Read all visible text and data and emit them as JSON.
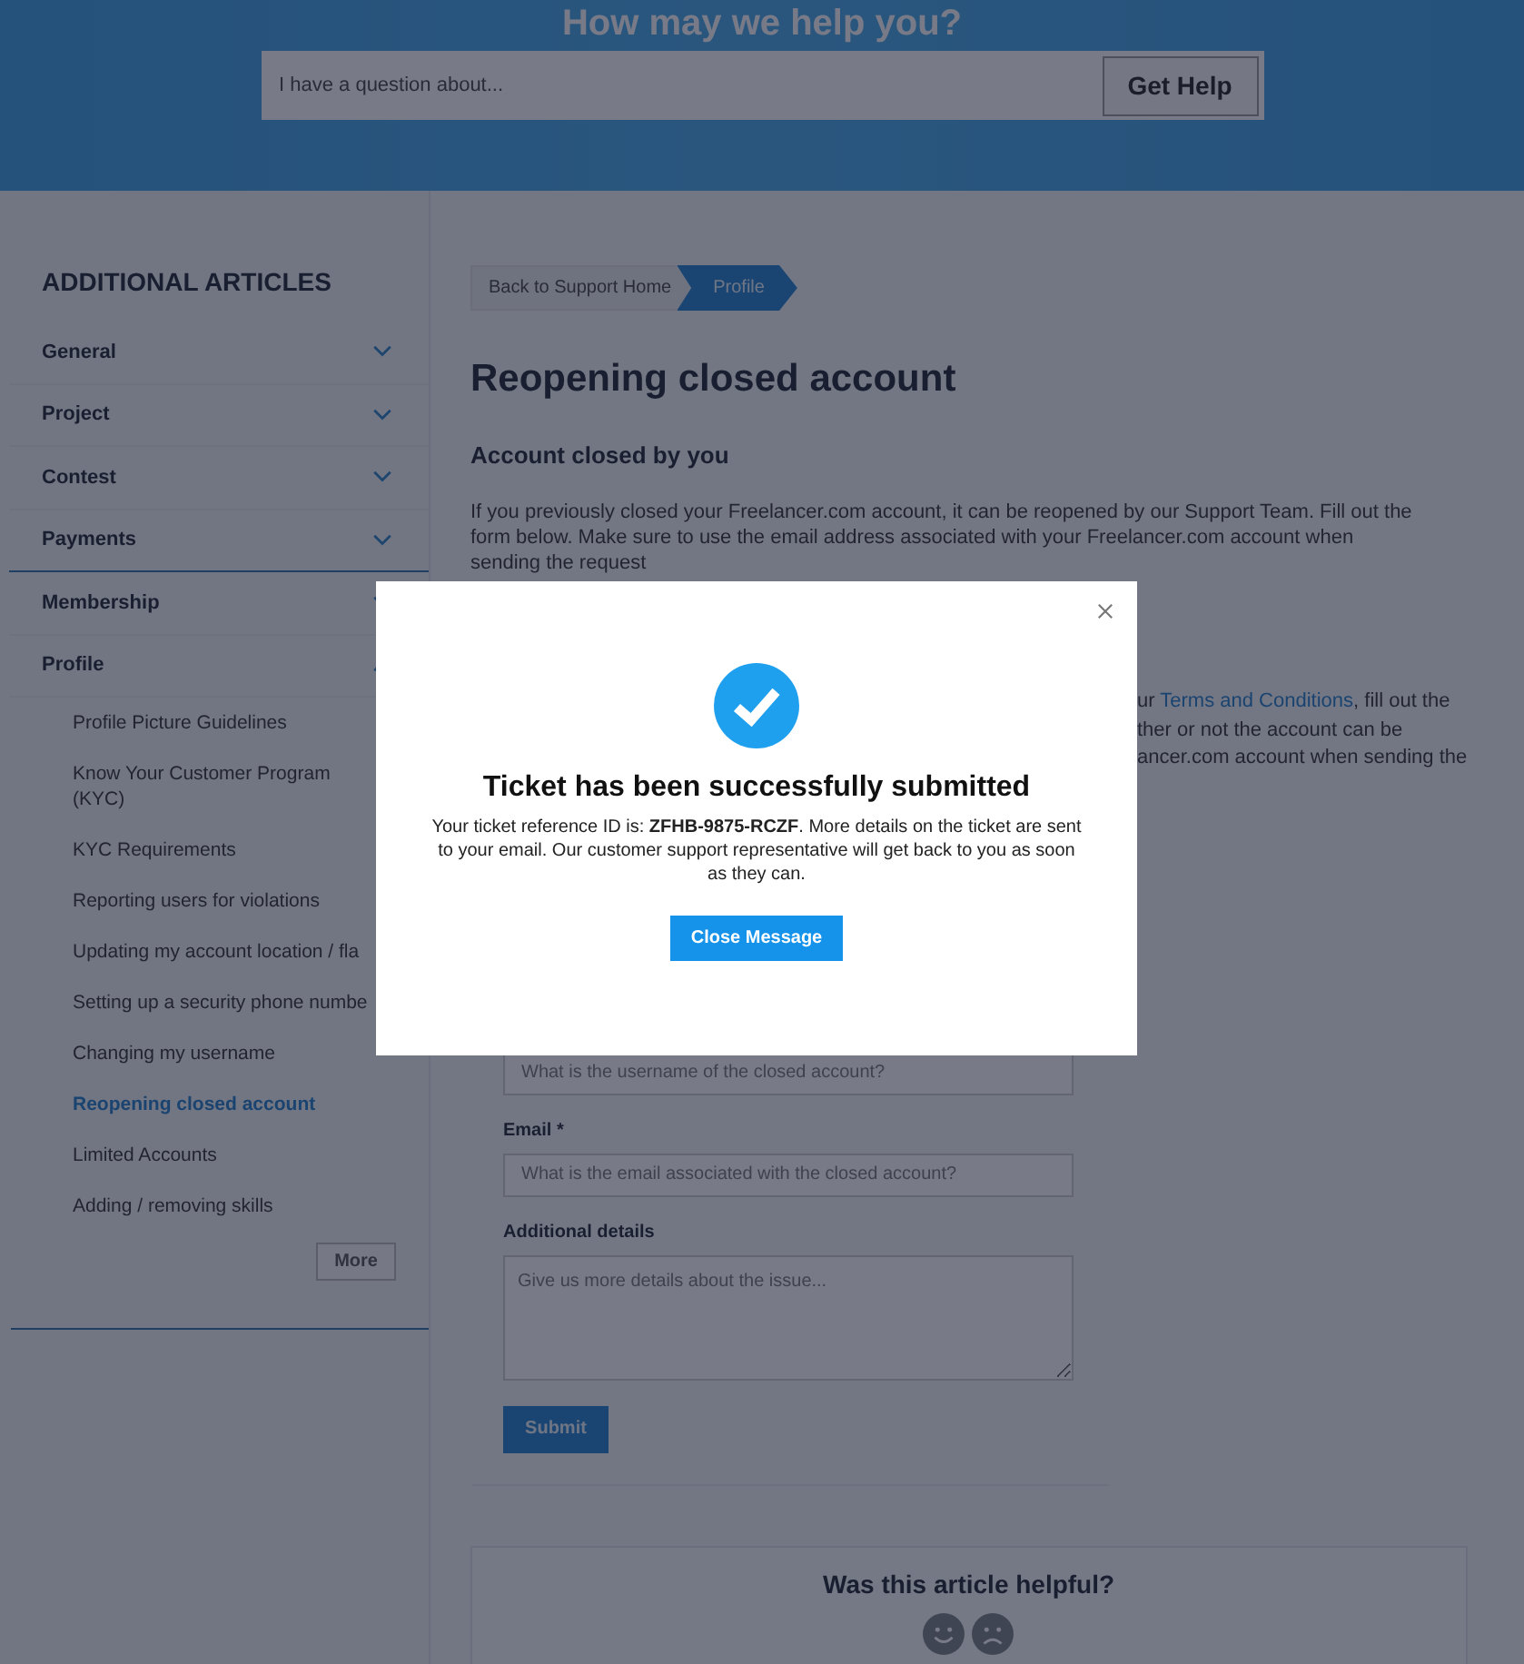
{
  "header": {
    "title": "How may we help you?",
    "search": {
      "placeholder": "I have a question about..."
    },
    "button": "Get Help"
  },
  "sidebar": {
    "title": "ADDITIONAL ARTICLES",
    "categories": [
      {
        "label": "General",
        "expanded": false
      },
      {
        "label": "Project",
        "expanded": false
      },
      {
        "label": "Contest",
        "expanded": false
      },
      {
        "label": "Payments",
        "expanded": false
      },
      {
        "label": "Membership",
        "expanded": false
      },
      {
        "label": "Profile",
        "expanded": true,
        "items": [
          {
            "label": "Profile Picture Guidelines",
            "selected": false
          },
          {
            "label": "Know Your Customer Program (KYC)",
            "selected": false
          },
          {
            "label": "KYC Requirements",
            "selected": false
          },
          {
            "label": "Reporting users for violations",
            "selected": false
          },
          {
            "label": "Updating my account location / fla",
            "selected": false
          },
          {
            "label": "Setting up a security phone numbe",
            "selected": false
          },
          {
            "label": "Changing my username",
            "selected": false
          },
          {
            "label": "Reopening closed account",
            "selected": true
          },
          {
            "label": "Limited Accounts",
            "selected": false
          },
          {
            "label": "Adding / removing skills",
            "selected": false
          }
        ]
      }
    ],
    "more_button": "More"
  },
  "breadcrumb": [
    "Back to Support Home",
    "Profile"
  ],
  "article": {
    "title": "Reopening closed account",
    "subtitle": "Account closed by you",
    "paragraph": "If you previously closed your Freelancer.com account, it can be reopened by our Support Team. Fill out the form below. Make sure to use the email address associated with your Freelancer.com account when sending the request",
    "fragment": {
      "before_link": "ur ",
      "link": "Terms and Conditions",
      "after_link": ", fill out the",
      "lines": [
        "ther or not the account can be",
        "ancer.com account when sending the"
      ]
    }
  },
  "form": {
    "fields": [
      {
        "kind": "input",
        "placeholder": "What is the username of the closed account?"
      },
      {
        "kind": "input",
        "label": "Email *",
        "placeholder": "What is the email associated with the closed account?"
      },
      {
        "kind": "textarea",
        "label": "Additional details",
        "placeholder": "Give us more details about the issue..."
      }
    ],
    "submit": "Submit"
  },
  "feedback": {
    "question": "Was this article helpful?"
  },
  "modal": {
    "title": "Ticket has been successfully submitted",
    "message": "Your ticket reference ID is: **ZFHB-9875-RCZF**. More details on the ticket are sent to your email. Our customer support representative will get back to you as soon as they can.",
    "button": "Close Message"
  }
}
